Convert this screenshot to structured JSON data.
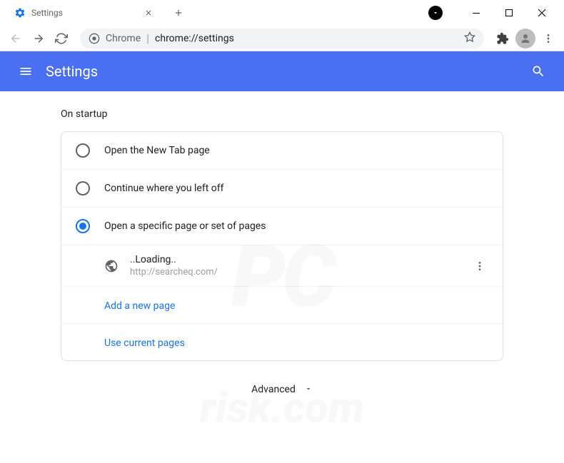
{
  "tab": {
    "title": "Settings"
  },
  "omnibox": {
    "prefix": "Chrome",
    "url": "chrome://settings"
  },
  "header": {
    "title": "Settings"
  },
  "section": {
    "title": "On startup",
    "radios": [
      {
        "label": "Open the New Tab page",
        "checked": false
      },
      {
        "label": "Continue where you left off",
        "checked": false
      },
      {
        "label": "Open a specific page or set of pages",
        "checked": true
      }
    ],
    "page": {
      "title": "..Loading..",
      "url": "http://searcheq.com/"
    },
    "add_link": "Add a new page",
    "use_link": "Use current pages"
  },
  "advanced": "Advanced"
}
